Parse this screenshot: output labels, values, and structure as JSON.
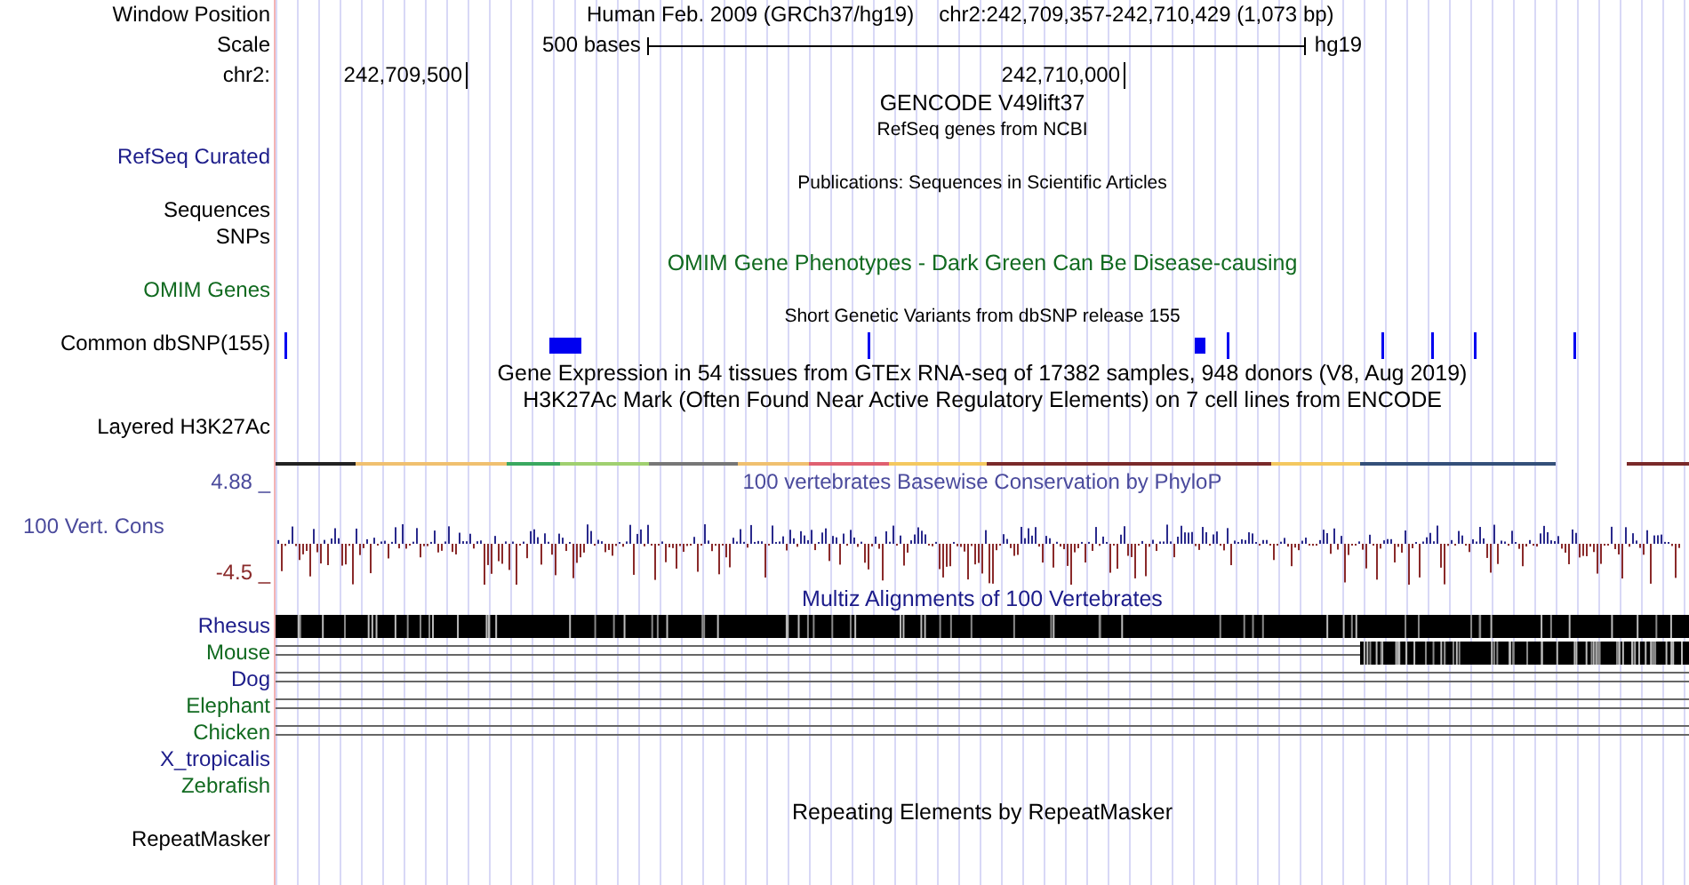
{
  "header": {
    "label": "Window Position",
    "assembly": "Human Feb. 2009 (GRCh37/hg19)",
    "position": "chr2:242,709,357-242,710,429 (1,073 bp)"
  },
  "scale": {
    "label": "Scale",
    "length": "500 bases",
    "assembly": "hg19"
  },
  "ruler": {
    "label": "chr2:",
    "ticks": [
      "242,709,500",
      "242,710,000"
    ]
  },
  "rows": [
    {
      "kind": "title",
      "title": "GENCODE V49lift37",
      "color": "#000000"
    },
    {
      "kind": "note",
      "title": "RefSeq genes from NCBI",
      "color": "#000000"
    },
    {
      "kind": "label",
      "label": "RefSeq Curated",
      "color": "#1c1c8a"
    },
    {
      "kind": "note",
      "title": "Publications: Sequences in Scientific Articles",
      "color": "#000000"
    },
    {
      "kind": "label",
      "label": "Sequences",
      "color": "#000000"
    },
    {
      "kind": "label",
      "label": "SNPs",
      "color": "#000000"
    },
    {
      "kind": "title",
      "title": "OMIM Gene Phenotypes - Dark Green Can Be Disease-causing",
      "color": "#116a20"
    },
    {
      "kind": "label",
      "label": "OMIM Genes",
      "color": "#116a20"
    },
    {
      "kind": "note",
      "title": "Short Genetic Variants from dbSNP release 155",
      "color": "#000000"
    },
    {
      "kind": "snps",
      "label": "Common dbSNP(155)",
      "color": "#000000"
    },
    {
      "kind": "title",
      "title": "Gene Expression in 54 tissues from GTEx RNA-seq of 17382 samples, 948 donors (V8, Aug 2019)",
      "color": "#000000"
    },
    {
      "kind": "title",
      "title": "H3K27Ac Mark (Often Found Near Active Regulatory Elements) on 7 cell lines from ENCODE",
      "color": "#000000"
    },
    {
      "kind": "label",
      "label": "Layered H3K27Ac",
      "color": "#000000"
    },
    {
      "kind": "signal"
    },
    {
      "kind": "wiggle",
      "title": "100 vertebrates Basewise Conservation by PhyloP",
      "max": "4.88 _",
      "label": "100 Vert. Cons",
      "min": "-4.5 _",
      "color": "#4a4a9c"
    },
    {
      "kind": "title",
      "title": "Multiz Alignments of 100 Vertebrates",
      "color": "#1c1c8a"
    },
    {
      "kind": "alignments",
      "species": [
        {
          "label": "Rhesus",
          "color": "#1c1c8a",
          "kind": "full"
        },
        {
          "label": "Mouse",
          "color": "#116a20",
          "kind": "partial"
        },
        {
          "label": "Dog",
          "color": "#1c1c8a",
          "kind": "lines"
        },
        {
          "label": "Elephant",
          "color": "#116a20",
          "kind": "lines"
        },
        {
          "label": "Chicken",
          "color": "#116a20",
          "kind": "lines"
        },
        {
          "label": "X_tropicalis",
          "color": "#1c1c8a",
          "kind": "none"
        },
        {
          "label": "Zebrafish",
          "color": "#116a20",
          "kind": "none"
        }
      ]
    },
    {
      "kind": "title",
      "title": "Repeating Elements by RepeatMasker",
      "color": "#000000"
    },
    {
      "kind": "label",
      "label": "RepeatMasker",
      "color": "#000000"
    }
  ]
}
